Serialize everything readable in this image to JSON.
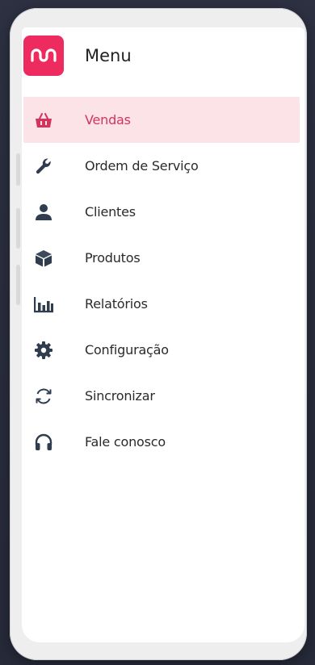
{
  "header": {
    "title": "Menu",
    "logo_icon": "brand-wave-logo"
  },
  "colors": {
    "accent": "#ee2b5f",
    "active_bg": "#fbe3e7",
    "icon": "#2f3d4f"
  },
  "menu": {
    "items": [
      {
        "label": "Vendas",
        "icon": "basket-icon",
        "active": true
      },
      {
        "label": "Ordem de Serviço",
        "icon": "wrench-icon",
        "active": false
      },
      {
        "label": "Clientes",
        "icon": "person-icon",
        "active": false
      },
      {
        "label": "Produtos",
        "icon": "box-icon",
        "active": false
      },
      {
        "label": "Relatórios",
        "icon": "bar-chart-icon",
        "active": false
      },
      {
        "label": "Configuração",
        "icon": "gear-icon",
        "active": false
      },
      {
        "label": "Sincronizar",
        "icon": "sync-icon",
        "active": false
      },
      {
        "label": "Fale conosco",
        "icon": "headphones-icon",
        "active": false
      }
    ]
  }
}
